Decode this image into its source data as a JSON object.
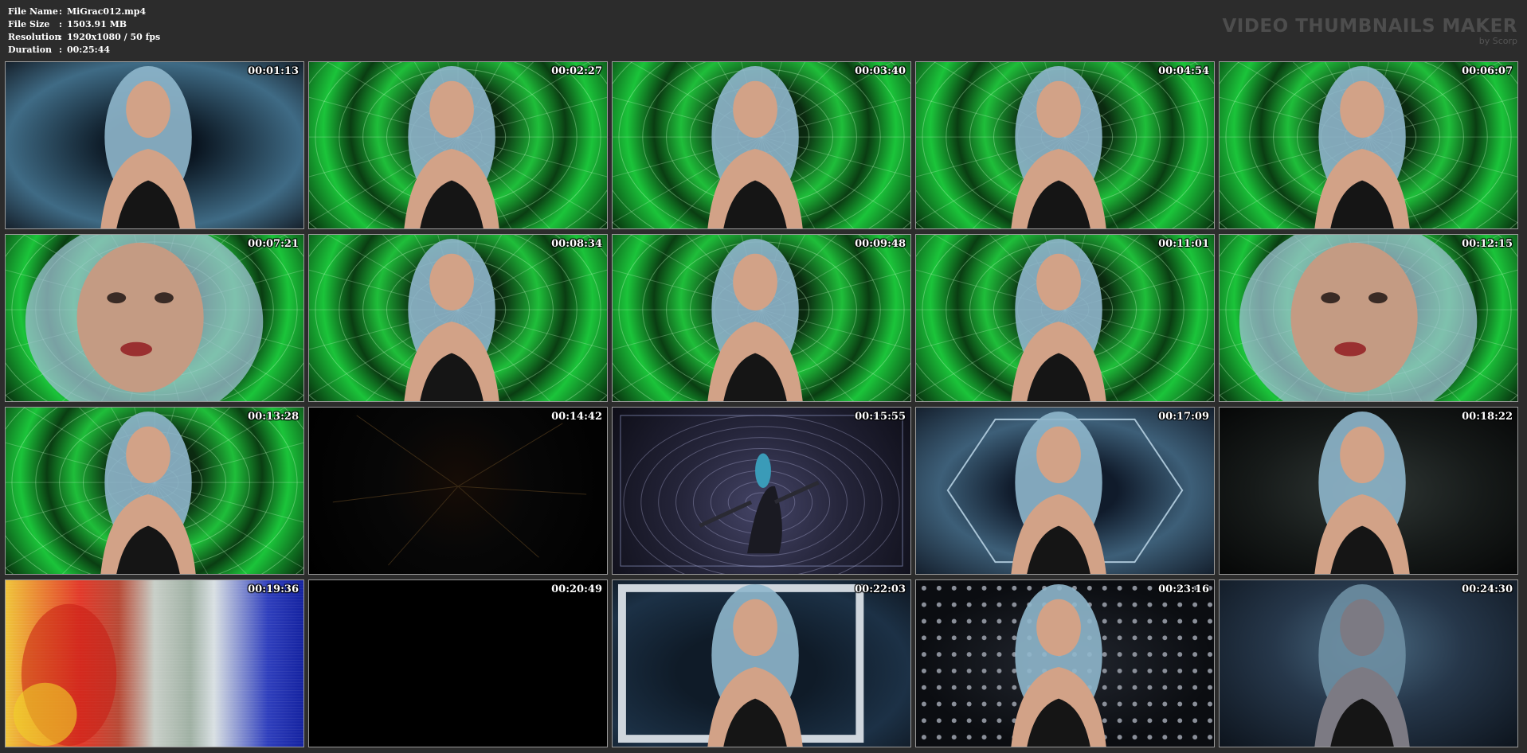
{
  "info": {
    "file_name": {
      "label": "File Name",
      "value": "MiGrac012.mp4"
    },
    "file_size": {
      "label": "File Size",
      "value": "1503.91 MB"
    },
    "resolution": {
      "label": "Resolution",
      "value": "1920x1080 / 50 fps"
    },
    "duration": {
      "label": "Duration",
      "value": "00:25:44"
    },
    "separator": ":"
  },
  "brand": {
    "title": "VIDEO THUMBNAILS MAKER",
    "subtitle": "by Scorp"
  },
  "thumbnails": [
    {
      "timestamp": "00:01:13",
      "scene": "blue-tunnel"
    },
    {
      "timestamp": "00:02:27",
      "scene": "green-spiral"
    },
    {
      "timestamp": "00:03:40",
      "scene": "green-spiral"
    },
    {
      "timestamp": "00:04:54",
      "scene": "green-spiral"
    },
    {
      "timestamp": "00:06:07",
      "scene": "green-spiral"
    },
    {
      "timestamp": "00:07:21",
      "scene": "green-spiral-closeup"
    },
    {
      "timestamp": "00:08:34",
      "scene": "green-spiral"
    },
    {
      "timestamp": "00:09:48",
      "scene": "green-spiral"
    },
    {
      "timestamp": "00:11:01",
      "scene": "green-spiral"
    },
    {
      "timestamp": "00:12:15",
      "scene": "green-spiral-closeup"
    },
    {
      "timestamp": "00:13:28",
      "scene": "green-spiral"
    },
    {
      "timestamp": "00:14:42",
      "scene": "dark-lightning"
    },
    {
      "timestamp": "00:15:55",
      "scene": "hud-tunnel"
    },
    {
      "timestamp": "00:17:09",
      "scene": "hex-tunnel"
    },
    {
      "timestamp": "00:18:22",
      "scene": "smoke"
    },
    {
      "timestamp": "00:19:36",
      "scene": "rainbow-glitch"
    },
    {
      "timestamp": "00:20:49",
      "scene": "black"
    },
    {
      "timestamp": "00:22:03",
      "scene": "silver-frame"
    },
    {
      "timestamp": "00:23:16",
      "scene": "dot-wall"
    },
    {
      "timestamp": "00:24:30",
      "scene": "fog"
    }
  ]
}
